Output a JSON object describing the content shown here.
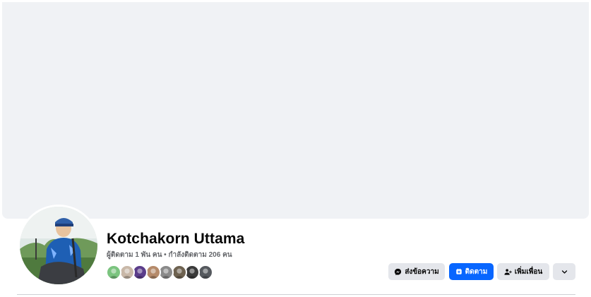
{
  "profile": {
    "name": "Kotchakorn Uttama",
    "stats": "ผู้ติดตาม 1 พัน คน • กำลังติดตาม 206 คน",
    "friend_avatar_colors": [
      "#7bc47f",
      "#c9b8a8",
      "#5b3d8a",
      "#b58a6a",
      "#8a8a8a",
      "#6e6250",
      "#3a3a3a",
      "#55595e"
    ]
  },
  "actions": {
    "message_label": "ส่งข้อความ",
    "follow_label": "ติดตาม",
    "add_friend_label": "เพิ่มเพื่อน",
    "more_icon": "chevron-down-icon"
  },
  "colors": {
    "primary": "#0866ff",
    "secondary_button": "#e4e6eb",
    "cover": "#f0f2f5"
  }
}
